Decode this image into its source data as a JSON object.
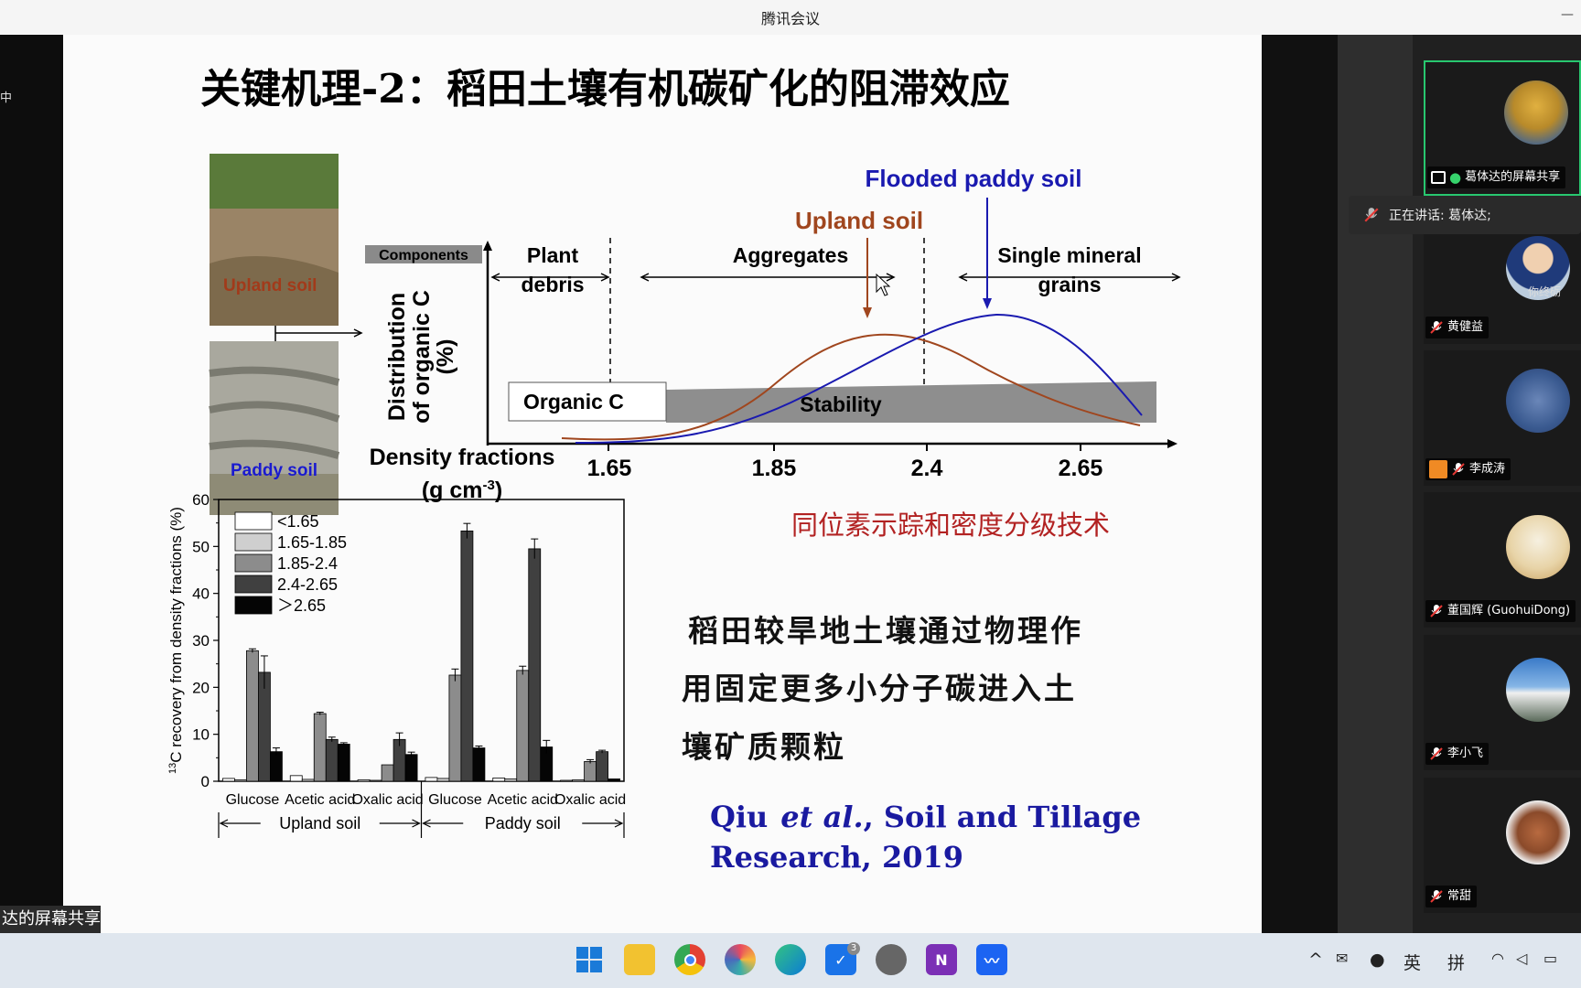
{
  "app": {
    "title": "腾讯会议",
    "share_label": "达的屏幕共享"
  },
  "slide": {
    "title": "关键机理-2：稻田土壤有机碳矿化的阻滞效应",
    "photos": {
      "upland_label": "Upland soil",
      "paddy_label": "Paddy soil"
    },
    "diagram": {
      "components_label": "Components",
      "plant_debris": [
        "Plant",
        "debris"
      ],
      "aggregates": "Aggregates",
      "single_mineral": [
        "Single mineral",
        "grains"
      ],
      "upland_soil": "Upland soil",
      "flooded_paddy_soil": "Flooded paddy soil",
      "ylabel": [
        "Distribution",
        "of organic C",
        "(%)"
      ],
      "organic_c": "Organic C",
      "stability": "Stability",
      "density_label": "Density fractions",
      "density_unit_prefix": "(g cm",
      "density_unit_sup": "-3",
      "density_unit_suffix": ")",
      "ticks": [
        "1.65",
        "1.85",
        "2.4",
        "2.65"
      ]
    },
    "technique_caption": "同位素示踪和密度分级技术",
    "conclusion_lines": [
      "稻田较旱地土壤通过物理作",
      "用固定更多小分子碳进入土",
      "壤矿质颗粒"
    ],
    "citation": {
      "author": "Qiu",
      "etal": "et al.",
      "journal": ", Soil and Tillage",
      "line2": "Research, 2019"
    }
  },
  "chart_data": {
    "type": "bar",
    "ylabel_sup": "13",
    "ylabel": "C recovery from density fractions (%)",
    "ylim": [
      0,
      60
    ],
    "yticks": [
      "0",
      "10",
      "20",
      "30",
      "40",
      "50",
      "60"
    ],
    "categories": [
      "Glucose",
      "Acetic acid",
      "Oxalic acid",
      "Glucose",
      "Acetic acid",
      "Oxalic acid"
    ],
    "groups": [
      {
        "label": "Upland soil"
      },
      {
        "label": "Paddy soil"
      }
    ],
    "series": [
      {
        "name": "<1.65",
        "color": "#ffffff",
        "values": [
          0.6,
          1.2,
          0.3,
          0.8,
          0.7,
          0.2
        ]
      },
      {
        "name": "1.65-1.85",
        "color": "#cfcfcf",
        "values": [
          0.3,
          0.4,
          0.2,
          0.6,
          0.5,
          0.3
        ]
      },
      {
        "name": "1.85-2.4",
        "color": "#8c8c8c",
        "values": [
          27.8,
          14.4,
          3.5,
          22.6,
          23.6,
          4.2
        ]
      },
      {
        "name": "2.4-2.65",
        "color": "#404040",
        "values": [
          23.2,
          8.9,
          8.9,
          53.3,
          49.5,
          6.3
        ]
      },
      {
        "name": "＞2.65",
        "color": "#050505",
        "values": [
          6.3,
          7.9,
          5.7,
          7.1,
          7.3,
          0.5
        ]
      }
    ],
    "errors": [
      [
        0.1,
        0.1,
        0.1,
        0.1,
        0.1,
        0.1
      ],
      [
        0.1,
        0.1,
        0.1,
        0.1,
        0.1,
        0.1
      ],
      [
        0.4,
        0.3,
        0.2,
        1.3,
        0.9,
        0.4
      ],
      [
        3.5,
        0.5,
        1.4,
        1.6,
        2.1,
        0.3
      ],
      [
        0.8,
        0.3,
        0.5,
        0.4,
        1.4,
        0.1
      ]
    ]
  },
  "participants": [
    {
      "name": "葛体达的屏幕共享",
      "active": true
    },
    {
      "name": "黄健益",
      "avatar_text": "你终砺"
    },
    {
      "name": "李成涛"
    },
    {
      "name": "董国辉 (GuohuiDong)"
    },
    {
      "name": "李小飞"
    },
    {
      "name": "常甜"
    }
  ],
  "speaking": "正在讲话: 葛体达;",
  "taskbar": {
    "apps": [
      "start-icon",
      "file-explorer-icon",
      "chrome-icon",
      "photos-icon",
      "edge-icon",
      "teams-icon",
      "clock-icon",
      "onenote-icon",
      "tencent-meeting-icon"
    ],
    "badge_count": "3",
    "tray": [
      "^",
      "英",
      "拼"
    ]
  }
}
